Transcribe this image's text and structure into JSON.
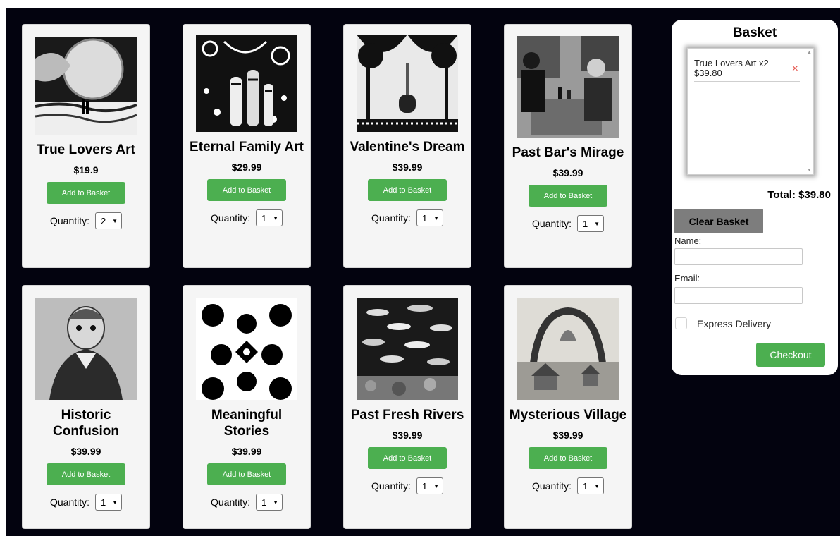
{
  "products": [
    {
      "title": "True Lovers Art",
      "price": "$19.9",
      "add_label": "Add to Basket",
      "qty_label": "Quantity:",
      "qty": "2",
      "art_icon": "moon-lovers-art"
    },
    {
      "title": "Eternal Family Art",
      "price": "$29.99",
      "add_label": "Add to Basket",
      "qty_label": "Quantity:",
      "qty": "1",
      "art_icon": "family-swirl-art"
    },
    {
      "title": "Valentine's Dream",
      "price": "$39.99",
      "add_label": "Add to Basket",
      "qty_label": "Quantity:",
      "qty": "1",
      "art_icon": "trees-couple-art"
    },
    {
      "title": "Past Bar's Mirage",
      "price": "$39.99",
      "add_label": "Add to Basket",
      "qty_label": "Quantity:",
      "qty": "1",
      "art_icon": "bar-men-art"
    },
    {
      "title": "Historic Confusion",
      "price": "$39.99",
      "add_label": "Add to Basket",
      "qty_label": "Quantity:",
      "qty": "1",
      "art_icon": "portrait-man-art"
    },
    {
      "title": "Meaningful Stories",
      "price": "$39.99",
      "add_label": "Add to Basket",
      "qty_label": "Quantity:",
      "qty": "1",
      "art_icon": "floral-pattern-art"
    },
    {
      "title": "Past Fresh Rivers",
      "price": "$39.99",
      "add_label": "Add to Basket",
      "qty_label": "Quantity:",
      "qty": "1",
      "art_icon": "fish-school-art"
    },
    {
      "title": "Mysterious Village",
      "price": "$39.99",
      "add_label": "Add to Basket",
      "qty_label": "Quantity:",
      "qty": "1",
      "art_icon": "village-arch-art"
    }
  ],
  "basket": {
    "title": "Basket",
    "items": [
      {
        "line1": "True Lovers Art x2",
        "line2": "$39.80",
        "remove": "×"
      }
    ],
    "total": "Total: $39.80",
    "clear_label": "Clear Basket",
    "name_label": "Name:",
    "name_value": "",
    "email_label": "Email:",
    "email_value": "",
    "express_label": "Express Delivery",
    "express_checked": false,
    "checkout_label": "Checkout"
  },
  "colors": {
    "page_bg": "#03030f",
    "accent": "#4caf50",
    "clear_bg": "#7d7d7d",
    "remove": "#e5534b"
  }
}
